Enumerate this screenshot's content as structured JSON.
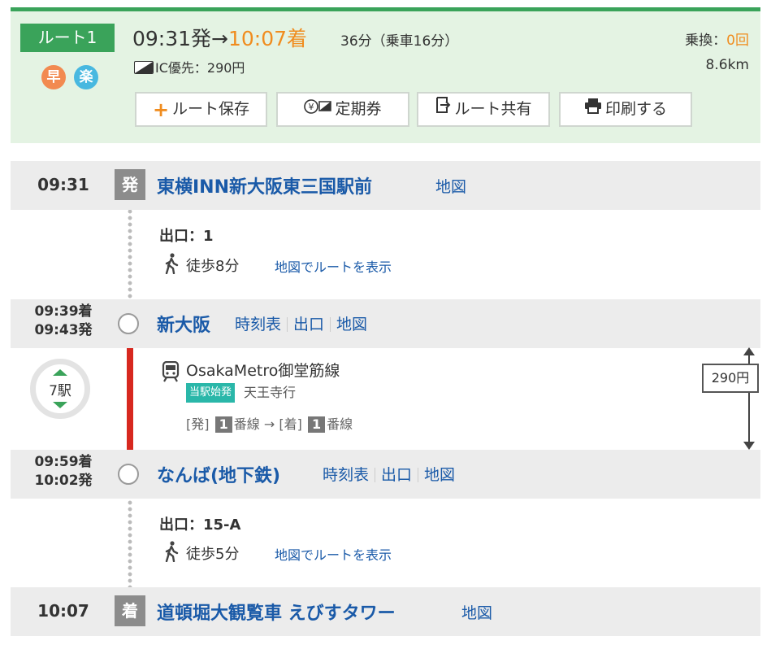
{
  "header": {
    "route_label": "ルート1",
    "fast_icon": "早",
    "easy_icon": "楽",
    "depart_time": "09:31発",
    "arrow": "→",
    "arrive_time": "10:07着",
    "duration": "36分（乗車16分）",
    "transfer_label": "乗換：",
    "transfer_count": "0回",
    "fare": "IC優先：290円",
    "distance": "8.6km",
    "accent_color": "#3aa35a",
    "highlight_color": "#f08c1e",
    "buttons": [
      {
        "label": "ルート保存",
        "icon": "plus-icon"
      },
      {
        "label": "定期券",
        "icon": "commuter-pass-icon"
      },
      {
        "label": "ルート共有",
        "icon": "share-icon"
      },
      {
        "label": "印刷する",
        "icon": "printer-icon"
      }
    ]
  },
  "route": {
    "start": {
      "time": "09:31",
      "marker": "発",
      "name": "東横INN新大阪東三国駅前",
      "map_link": "地図",
      "exit": "出口：1",
      "walk": "徒歩8分",
      "walk_map_link": "地図でルートを表示"
    },
    "station1": {
      "arrive": "09:39着",
      "depart": "09:43発",
      "name": "新大阪",
      "links": [
        "時刻表",
        "出口",
        "地図"
      ]
    },
    "segment": {
      "stops": "7駅",
      "line_name": "OsakaMetro御堂筋線",
      "origin_badge": "当駅始発",
      "direction": "天王寺行",
      "platform_depart_label": "[発]",
      "platform_depart_num": "1",
      "platform_line": "番線",
      "platform_arrow": "→",
      "platform_arrive_label": "[着]",
      "platform_arrive_num": "1",
      "fare": "290円",
      "line_color": "#d7281f"
    },
    "station2": {
      "arrive": "09:59着",
      "depart": "10:02発",
      "name": "なんば(地下鉄)",
      "links": [
        "時刻表",
        "出口",
        "地図"
      ],
      "exit": "出口：15-A",
      "walk": "徒歩5分",
      "walk_map_link": "地図でルートを表示"
    },
    "end": {
      "time": "10:07",
      "marker": "着",
      "name": "道頓堀大観覧車 えびすタワー",
      "map_link": "地図"
    }
  }
}
